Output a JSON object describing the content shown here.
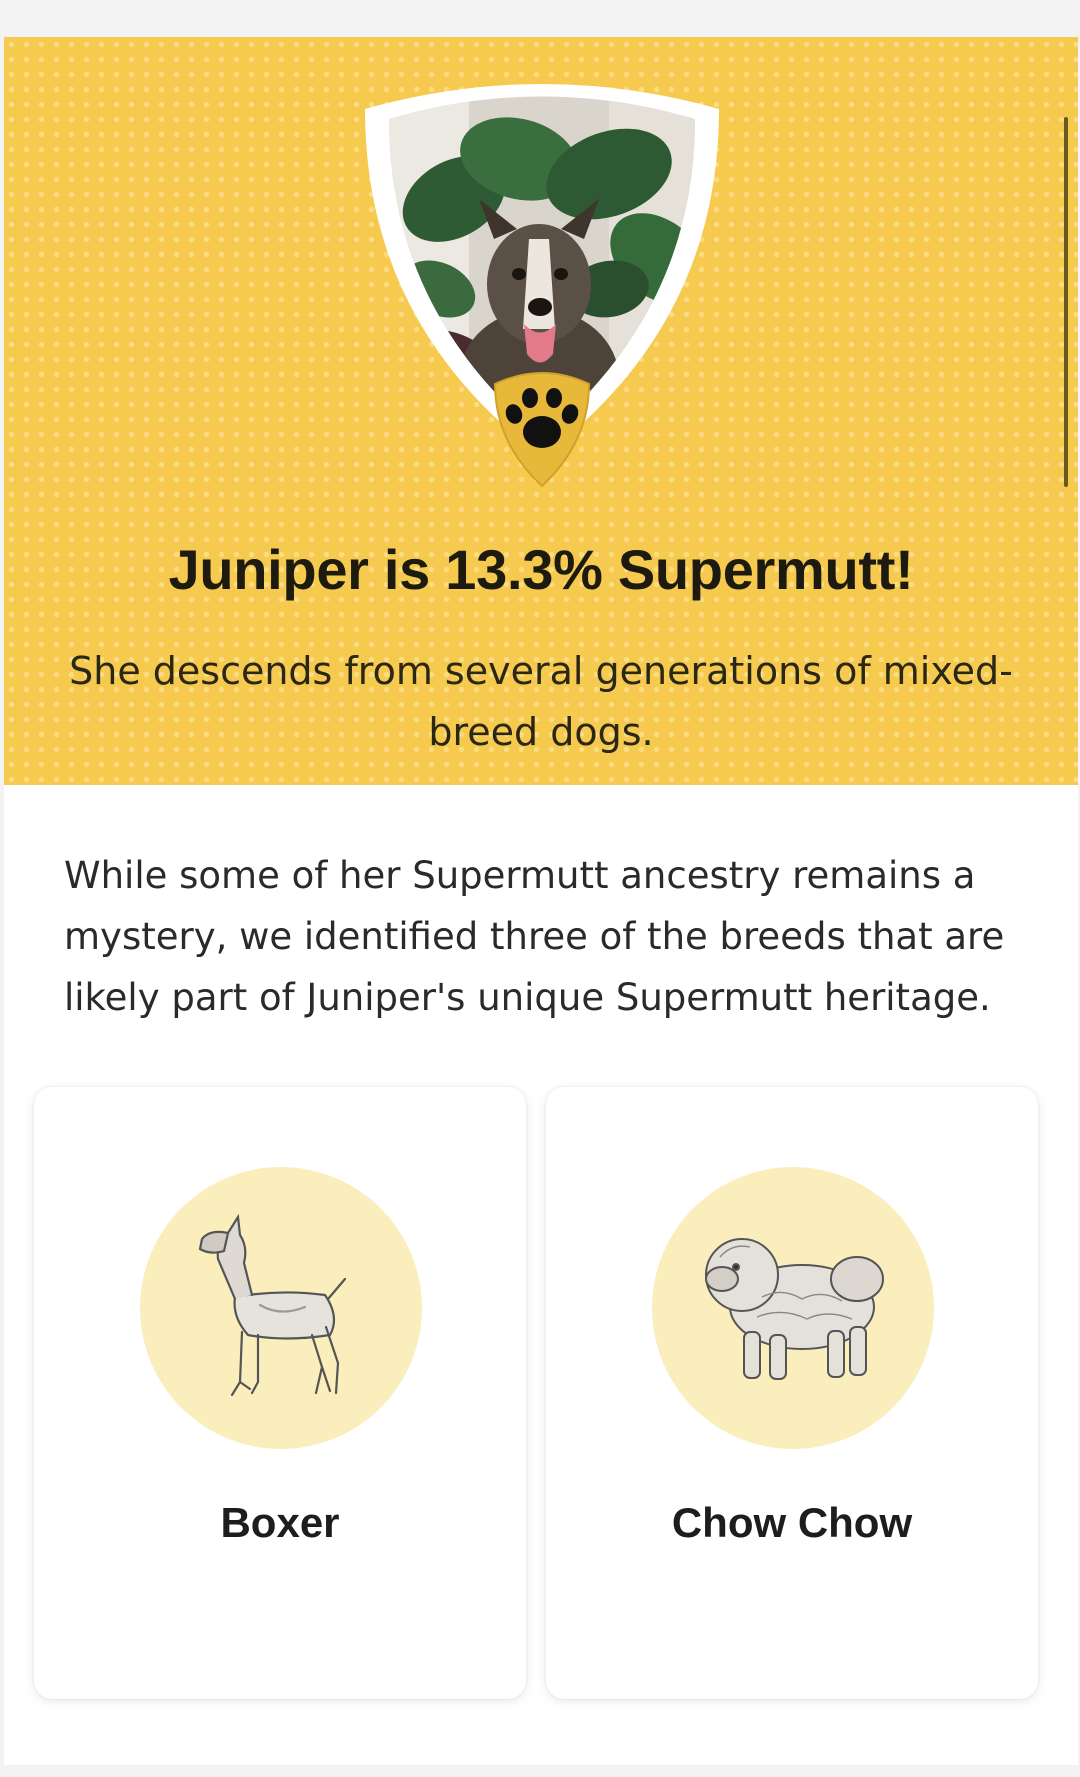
{
  "hero": {
    "title": "Juniper is 13.3% Supermutt!",
    "subtitle": "She descends from several generations of mixed-breed dogs.",
    "background_color": "#f6c94f",
    "profile_photo": "dog-portrait-with-monstera-plant",
    "badge_icon": "paw-icon"
  },
  "intro": {
    "text": "While some of her Supermutt ancestry remains a mystery, we identified three of the breeds that are likely part of Juniper's unique Supermutt heritage."
  },
  "breeds": [
    {
      "name": "Boxer",
      "illustration": "boxer-illustration"
    },
    {
      "name": "Chow Chow",
      "illustration": "chow-chow-illustration"
    }
  ],
  "colors": {
    "accent": "#f6c94f",
    "breed_circle": "#fbeebd",
    "text_dark": "#1d1a10"
  }
}
